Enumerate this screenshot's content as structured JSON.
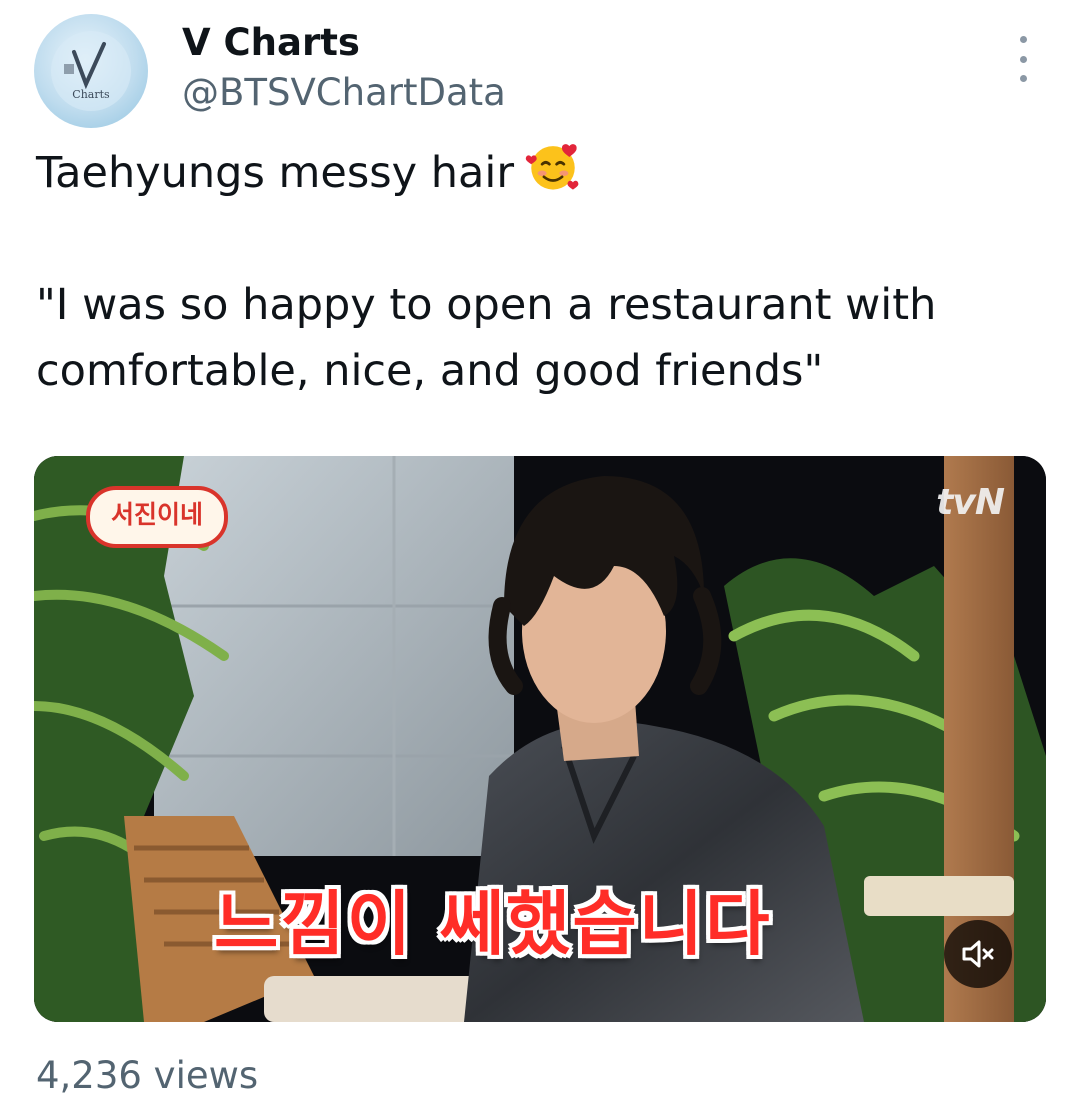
{
  "author": {
    "display_name": "V Charts",
    "handle": "@BTSVChartData",
    "avatar_text": "Charts"
  },
  "tweet": {
    "line1": "Taehyungs messy hair",
    "line1_emoji": "smiling-face-with-hearts-icon",
    "line2": "\"I was so happy to open a restaurant with",
    "line3": "comfortable, nice, and good friends\""
  },
  "video": {
    "show_logo": "서진이네",
    "channel_logo": "tvN",
    "subtitle": "느낌이 쎄했습니다",
    "mute_icon": "volume-muted-icon"
  },
  "stats": {
    "views": "4,236 views"
  },
  "colors": {
    "text_primary": "#0f1419",
    "text_secondary": "#536471",
    "subtitle_red": "#ff2d27"
  }
}
